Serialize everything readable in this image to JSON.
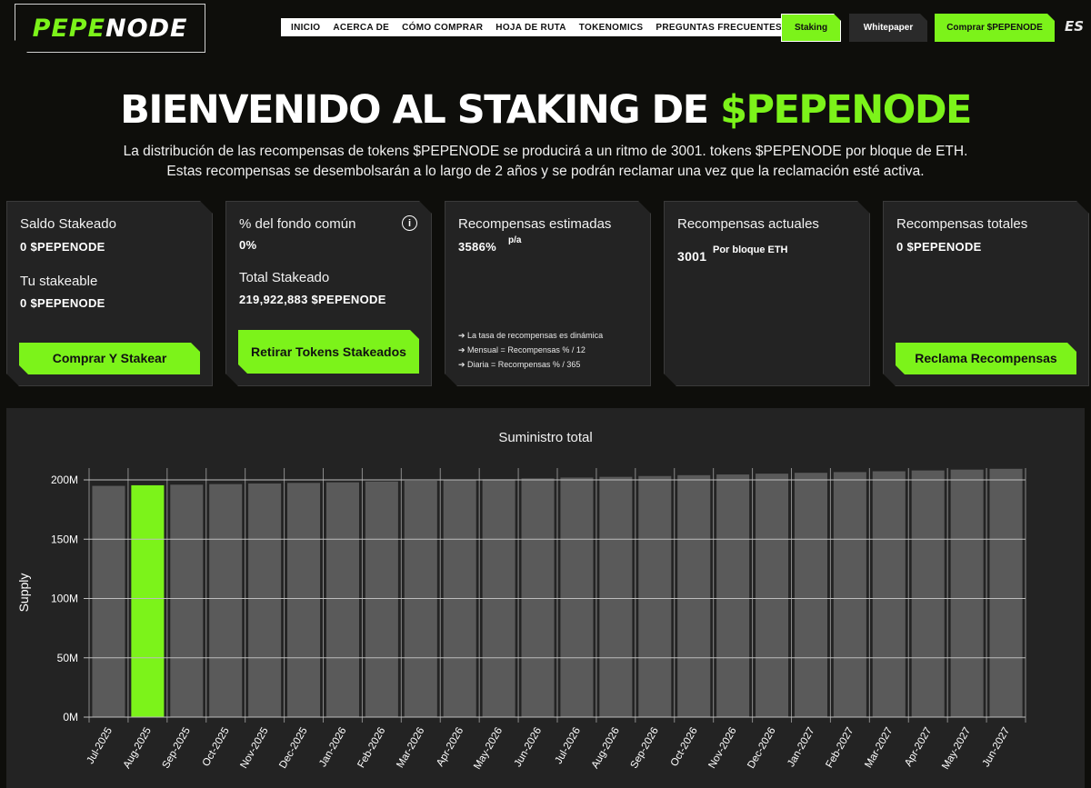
{
  "brand": {
    "logo_part1": "PEPE",
    "logo_part2": "NODE",
    "accent": "#7cf31a"
  },
  "nav": {
    "items": [
      "INICIO",
      "ACERCA DE",
      "CÓMO COMPRAR",
      "HOJA DE RUTA",
      "TOKENOMICS",
      "PREGUNTAS FRECUENTES"
    ],
    "staking": "Staking",
    "whitepaper": "Whitepaper",
    "buy": "Comprar $PEPENODE",
    "lang": "ES"
  },
  "hero": {
    "title_main": "BIENVENIDO AL STAKING DE ",
    "title_accent": "$PEPENODE",
    "sub1": "La distribución de las recompensas de tokens $PEPENODE se producirá a un ritmo de 3001. tokens $PEPENODE por bloque de ETH.",
    "sub2": "Estas recompensas se desembolsarán a lo largo de 2 años y se podrán reclamar una vez que la reclamación esté activa."
  },
  "cards": {
    "c1": {
      "label1": "Saldo Stakeado",
      "value1": "0 $PEPENODE",
      "label2": "Tu stakeable",
      "value2": "0 $PEPENODE",
      "button": "Comprar Y Stakear"
    },
    "c2": {
      "label1": "% del fondo común",
      "value1": "0%",
      "label2": "Total Stakeado",
      "value2": "219,922,883 $PEPENODE",
      "button": "Retirar Tokens Stakeados",
      "info": "i"
    },
    "c3": {
      "label": "Recompensas estimadas",
      "value": "3586%",
      "unit": "p/a",
      "notes": [
        "➔ La tasa de recompensas es dinámica",
        "➔ Mensual = Recompensas % / 12",
        "➔ Diaria = Recompensas % / 365"
      ]
    },
    "c4": {
      "label": "Recompensas actuales",
      "value": "3001",
      "unit": "Por bloque ETH"
    },
    "c5": {
      "label": "Recompensas totales",
      "value": "0 $PEPENODE",
      "button": "Reclama Recompensas"
    }
  },
  "chart_data": {
    "type": "bar",
    "title": "Suministro total",
    "ylabel": "Supply",
    "xlabel": "",
    "ylim": [
      0,
      210000000
    ],
    "yticks": [
      0,
      50000000,
      100000000,
      150000000,
      200000000
    ],
    "ytick_labels": [
      "0M",
      "50M",
      "100M",
      "150M",
      "200M"
    ],
    "grid": true,
    "highlight_index": 1,
    "bar_color": "#5a5a5a",
    "highlight_color": "#7cf31a",
    "categories": [
      "Jul-2025",
      "Aug-2025",
      "Sep-2025",
      "Oct-2025",
      "Nov-2025",
      "Dec-2025",
      "Jan-2026",
      "Feb-2026",
      "Mar-2026",
      "Apr-2026",
      "May-2026",
      "Jun-2026",
      "Jul-2026",
      "Aug-2026",
      "Sep-2026",
      "Oct-2026",
      "Nov-2026",
      "Dec-2026",
      "Jan-2027",
      "Feb-2027",
      "Mar-2027",
      "Apr-2027",
      "May-2027",
      "Jun-2027"
    ],
    "values": [
      195000000,
      195500000,
      196000000,
      196500000,
      197000000,
      197500000,
      198000000,
      198700000,
      199300000,
      200000000,
      200600000,
      201300000,
      202000000,
      202600000,
      203300000,
      204000000,
      204600000,
      205300000,
      206000000,
      206600000,
      207300000,
      208000000,
      208700000,
      209400000
    ]
  }
}
